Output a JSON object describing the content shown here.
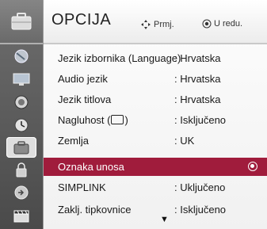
{
  "header": {
    "title": "OPCIJA",
    "hint_move_label": "Prmj.",
    "hint_ok_label": "U redu."
  },
  "sidebar": {
    "items": [
      {
        "icon": "settings-menu-icon",
        "selected": false
      },
      {
        "icon": "picture-icon",
        "selected": false
      },
      {
        "icon": "audio-icon",
        "selected": false
      },
      {
        "icon": "time-icon",
        "selected": false
      },
      {
        "icon": "option-icon",
        "selected": true
      },
      {
        "icon": "lock-icon",
        "selected": false
      },
      {
        "icon": "input-icon",
        "selected": false
      },
      {
        "icon": "usb-movie-icon",
        "selected": false
      }
    ]
  },
  "menu": {
    "rows": [
      {
        "label": "Jezik izbornika (Language)",
        "value": ": Hrvatska"
      },
      {
        "label": "Audio jezik",
        "value": ": Hrvatska"
      },
      {
        "label": "Jezik titlova",
        "value": ": Hrvatska"
      },
      {
        "label_before": "Nagluhost (",
        "label_after": ")",
        "value": ": Isključeno"
      },
      {
        "label": "Zemlja",
        "value": ": UK"
      },
      {
        "label": "Oznaka unosa",
        "value": ""
      },
      {
        "label": "SIMPLINK",
        "value": ": Uključeno"
      },
      {
        "label": "Zaklj. tipkovnice",
        "value": ": Isključeno"
      }
    ],
    "selected_index": 5
  },
  "colors": {
    "selected_row": "#a01c3c",
    "sidebar": "#5c5c5c"
  }
}
